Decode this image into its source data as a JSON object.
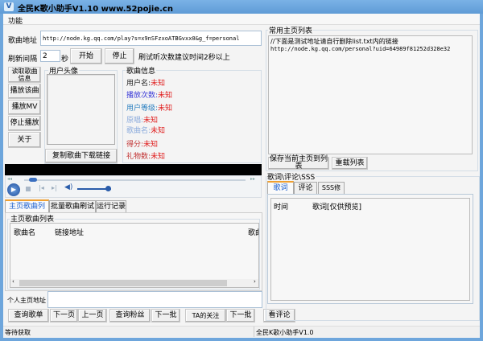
{
  "window": {
    "title": "全民K歌小助手V1.10 www.52pojie.cn",
    "icon": "V"
  },
  "menu": {
    "func": "功能"
  },
  "url_row": {
    "label": "歌曲地址",
    "value": "http://node.kg.qq.com/play?s=x9nSFzxoATBGvxx0&g_f=personal"
  },
  "refresh_row": {
    "label": "刷新间隔",
    "value": "2",
    "unit": "秒",
    "start": "开始",
    "stop": "停止",
    "hint": "刷试听次数建议时间2秒以上"
  },
  "left_buttons": [
    "读取歌曲信息",
    "播放该曲",
    "播放MV",
    "停止播放",
    "关于"
  ],
  "avatar": {
    "group_label": "用户头像",
    "copy_button": "复制歌曲下载链接"
  },
  "song_info": {
    "group_label": "歌曲信息",
    "items": [
      {
        "label": "用户名:",
        "value": "未知",
        "color": "#222222"
      },
      {
        "label": "播放次数:",
        "value": "未知",
        "color": "#3a3ad8"
      },
      {
        "label": "用户等级:",
        "value": "未知",
        "color": "#2a7fc0"
      },
      {
        "label": "原唱:",
        "value": "未知",
        "color": "#8aaadc"
      },
      {
        "label": "歌曲名:",
        "value": "未知",
        "color": "#8aaadc"
      },
      {
        "label": "得分:",
        "value": "未知",
        "color": "#c03030"
      },
      {
        "label": "礼物数:",
        "value": "未知",
        "color": "#c03030"
      }
    ]
  },
  "player": {
    "progress": 0.02,
    "volume": 0.9
  },
  "tabs": [
    "主页歌曲列表",
    "批量歌曲刷试听",
    "运行记录"
  ],
  "song_list": {
    "group_label": "主页歌曲列表",
    "columns": [
      "歌曲名",
      "链接地址",
      "歌曲"
    ]
  },
  "homepage": {
    "label": "个人主页地址",
    "value": ""
  },
  "bottom_buttons": [
    "查询歌单",
    "下一页",
    "上一页",
    "查询粉丝",
    "下一批",
    "TA的关注",
    "下一批",
    "看评论"
  ],
  "status": {
    "left": "等待获取",
    "right": "全民K歌小助手V1.0"
  },
  "fav_list": {
    "group_label": "常用主页列表",
    "lines": [
      "//下面是测试地址请自行删除list.txt内的链接",
      "http://node.kg.qq.com/personal?uid=64989f81252d328e32"
    ],
    "save": "保存当前主页到列表",
    "reload": "重载列表"
  },
  "lyrics": {
    "group_label": "歌词\\评论\\SSS",
    "tabs": [
      "歌词",
      "评论",
      "SSS修改"
    ],
    "columns": [
      "时间",
      "歌词[仅供预览]"
    ]
  }
}
